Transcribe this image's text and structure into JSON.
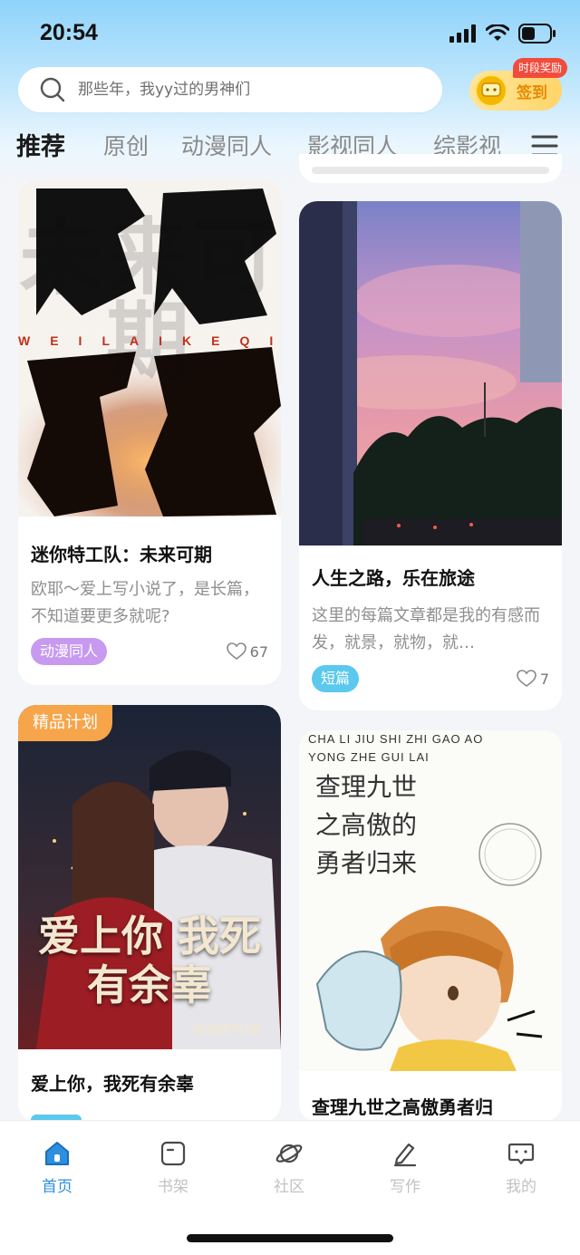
{
  "status_bar": {
    "time": "20:54"
  },
  "search": {
    "placeholder": "那些年，我yy过的男神们"
  },
  "signin": {
    "label": "签到",
    "badge": "时段奖励"
  },
  "categories": [
    "推荐",
    "原创",
    "动漫同人",
    "影视同人",
    "综影视"
  ],
  "cards": [
    {
      "cover_title": "未来可期",
      "cover_subtitle": "WEILAIKEQI",
      "title": "迷你特工队：未来可期",
      "desc": "欧耶～爱上写小说了，是长篇，不知道要更多就呢?",
      "tag": "动漫同人",
      "likes": "67"
    },
    {
      "title": "人生之路，乐在旅途",
      "desc": "这里的每篇文章都是我的有感而发，就景，就物，就…",
      "tag": "短篇",
      "likes": "7"
    },
    {
      "ribbon": "精品计划",
      "cover_title": "爱上你 我死有余辜",
      "cover_author": "呦呦鹿鸣/著",
      "title": "爱上你，我死有余辜"
    },
    {
      "cover_pinyin": "CHA LI JIU SHI ZHI GAO AO YONG ZHE GUI LAI",
      "cover_title": "查理九世 之高傲的 勇者归来",
      "title": "查理九世之高傲勇者归"
    }
  ],
  "bottom_nav": [
    "首页",
    "书架",
    "社区",
    "写作",
    "我的"
  ],
  "colors": {
    "accent": "#2c8fe0",
    "tag_purple": "#c79af0",
    "tag_cyan": "#5bc8ee",
    "ribbon_orange": "#f6a54a"
  }
}
